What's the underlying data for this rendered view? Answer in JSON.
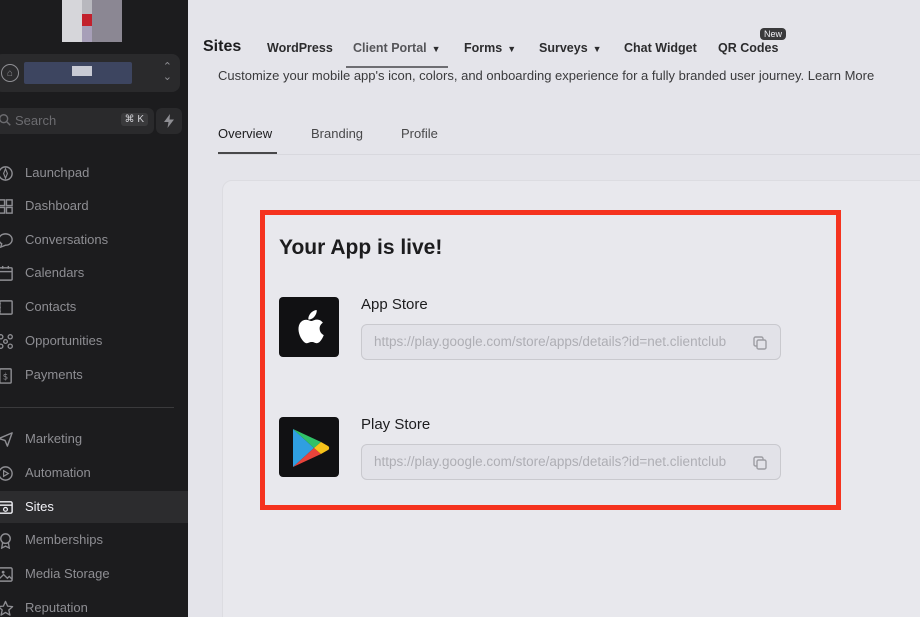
{
  "sidebar": {
    "search_label": "Search",
    "search_shortcut": "⌘ K",
    "items": [
      {
        "label": "Launchpad",
        "icon": "launchpad-icon"
      },
      {
        "label": "Dashboard",
        "icon": "dashboard-icon"
      },
      {
        "label": "Conversations",
        "icon": "chat-bubble-icon"
      },
      {
        "label": "Calendars",
        "icon": "calendar-icon"
      },
      {
        "label": "Contacts",
        "icon": "contacts-icon"
      },
      {
        "label": "Opportunities",
        "icon": "opportunities-icon"
      },
      {
        "label": "Payments",
        "icon": "payments-icon"
      },
      {
        "label": "Marketing",
        "icon": "send-icon"
      },
      {
        "label": "Automation",
        "icon": "automation-icon"
      },
      {
        "label": "Sites",
        "icon": "sites-icon",
        "active": true
      },
      {
        "label": "Memberships",
        "icon": "memberships-icon"
      },
      {
        "label": "Media Storage",
        "icon": "image-icon"
      },
      {
        "label": "Reputation",
        "icon": "star-icon"
      }
    ]
  },
  "header": {
    "title": "Sites",
    "nav": [
      {
        "label": "WordPress"
      },
      {
        "label": "Client Portal",
        "dropdown": true,
        "active": true
      },
      {
        "label": "Forms",
        "dropdown": true
      },
      {
        "label": "Surveys",
        "dropdown": true
      },
      {
        "label": "Chat Widget"
      },
      {
        "label": "QR Codes",
        "badge": "New"
      }
    ]
  },
  "page": {
    "subtitle": "Customize your mobile app's icon, colors, and onboarding experience for a fully branded user journey. Learn More",
    "tabs": [
      {
        "label": "Overview",
        "active": true
      },
      {
        "label": "Branding"
      },
      {
        "label": "Profile"
      }
    ]
  },
  "app_live": {
    "title": "Your App is live!",
    "stores": [
      {
        "label": "App Store",
        "url": "https://play.google.com/store/apps/details?id=net.clientclub",
        "icon": "apple-icon"
      },
      {
        "label": "Play Store",
        "url": "https://play.google.com/store/apps/details?id=net.clientclub",
        "icon": "google-play-icon"
      }
    ]
  },
  "colors": {
    "highlight": "#f5331f",
    "sidebar_bg": "#1c1c1e",
    "page_bg": "#e4e4ea"
  }
}
